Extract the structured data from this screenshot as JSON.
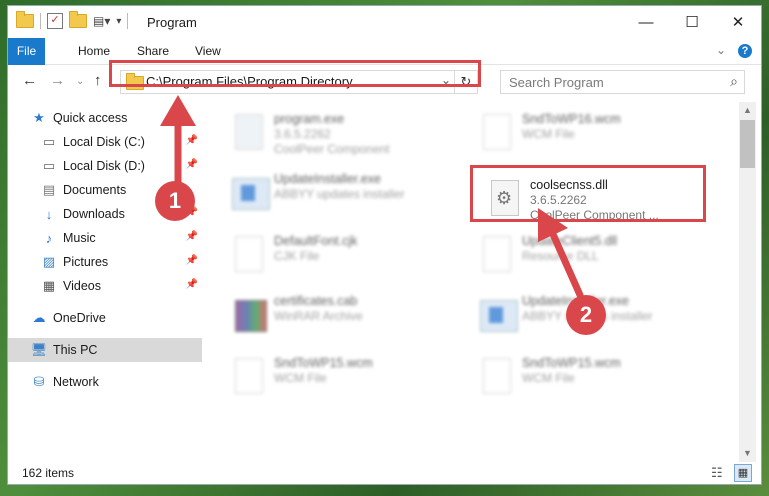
{
  "window": {
    "title": "Program"
  },
  "ribbon": {
    "tabs": [
      "File",
      "Home",
      "Share",
      "View"
    ]
  },
  "address": {
    "path": "C:\\Program Files\\Program Directory"
  },
  "search": {
    "placeholder": "Search Program"
  },
  "sidebar": {
    "items": [
      {
        "label": "Quick access",
        "icon": "star-icon"
      },
      {
        "label": "Local Disk (C:)",
        "icon": "drive-icon"
      },
      {
        "label": "Local Disk (D:)",
        "icon": "drive-icon"
      },
      {
        "label": "Documents",
        "icon": "documents-icon"
      },
      {
        "label": "Downloads",
        "icon": "downloads-icon"
      },
      {
        "label": "Music",
        "icon": "music-icon"
      },
      {
        "label": "Pictures",
        "icon": "pictures-icon"
      },
      {
        "label": "Videos",
        "icon": "videos-icon"
      },
      {
        "label": "OneDrive",
        "icon": "cloud-icon"
      },
      {
        "label": "This PC",
        "icon": "computer-icon"
      },
      {
        "label": "Network",
        "icon": "network-icon"
      }
    ]
  },
  "files": [
    {
      "name": "program.exe",
      "sub1": "3.6.5.2262",
      "sub2": "CoolPeer Component",
      "icon": "app-icon"
    },
    {
      "name": "SndToWP16.wcm",
      "sub1": "WCM File",
      "sub2": "",
      "icon": "file-icon"
    },
    {
      "name": "UpdateInstaller.exe",
      "sub1": "ABBYY updates installer",
      "sub2": "",
      "icon": "installer-icon"
    },
    {
      "name": "coolsecnss.dll",
      "sub1": "3.6.5.2262",
      "sub2": "CoolPeer Component ...",
      "icon": "dll-gears-icon"
    },
    {
      "name": "DefaultFont.cjk",
      "sub1": "CJK File",
      "sub2": "",
      "icon": "file-icon"
    },
    {
      "name": "UpdateClient5.dll",
      "sub1": "Resource DLL",
      "sub2": "",
      "icon": "dll-icon"
    },
    {
      "name": "certificates.cab",
      "sub1": "WinRAR Archive",
      "sub2": "",
      "icon": "archive-icon"
    },
    {
      "name": "UpdateInstaller.exe",
      "sub1": "ABBYY updates installer",
      "sub2": "",
      "icon": "installer-icon"
    },
    {
      "name": "SndToWP15.wcm",
      "sub1": "WCM File",
      "sub2": "",
      "icon": "file-icon"
    },
    {
      "name": "SndToWP15.wcm",
      "sub1": "WCM File",
      "sub2": "",
      "icon": "file-icon"
    }
  ],
  "status": {
    "count": "162 items"
  },
  "annotations": {
    "step1": "1",
    "step2": "2"
  },
  "colors": {
    "accent": "#1979ca",
    "highlight": "#d9474b"
  }
}
